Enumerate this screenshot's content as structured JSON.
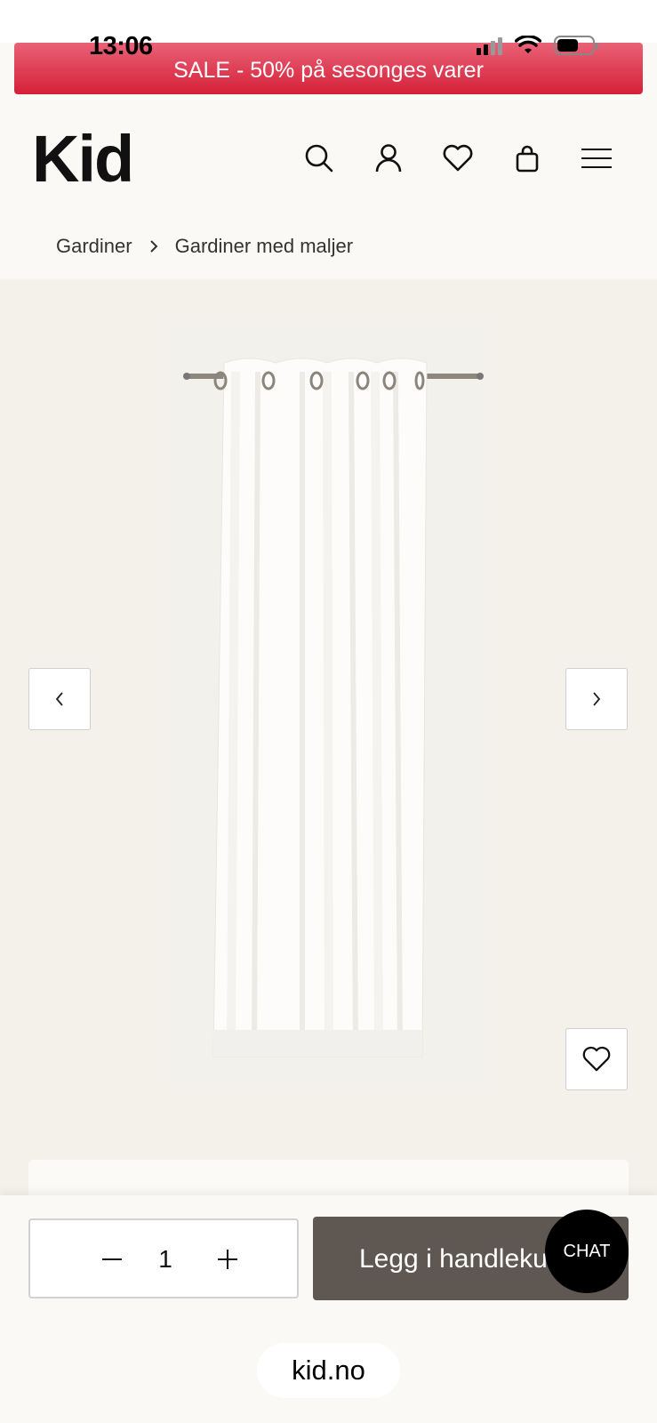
{
  "status_bar": {
    "time": "13:06"
  },
  "banner": {
    "text": "SALE - 50% på sesonges varer",
    "color": "#d8263d"
  },
  "header": {
    "logo": "Kid",
    "icons": [
      "search-icon",
      "account-icon",
      "heart-icon",
      "bag-icon",
      "menu-icon"
    ]
  },
  "breadcrumb": {
    "items": [
      "Gardiner",
      "Gardiner med maljer"
    ]
  },
  "gallery": {
    "image_alt": "White curtain with eyelets"
  },
  "purchase": {
    "quantity": "1",
    "add_to_cart_label": "Legg i handlekurv",
    "chat_label": "CHAT",
    "button_color": "#5f5852"
  },
  "browser": {
    "url": "kid.no"
  }
}
